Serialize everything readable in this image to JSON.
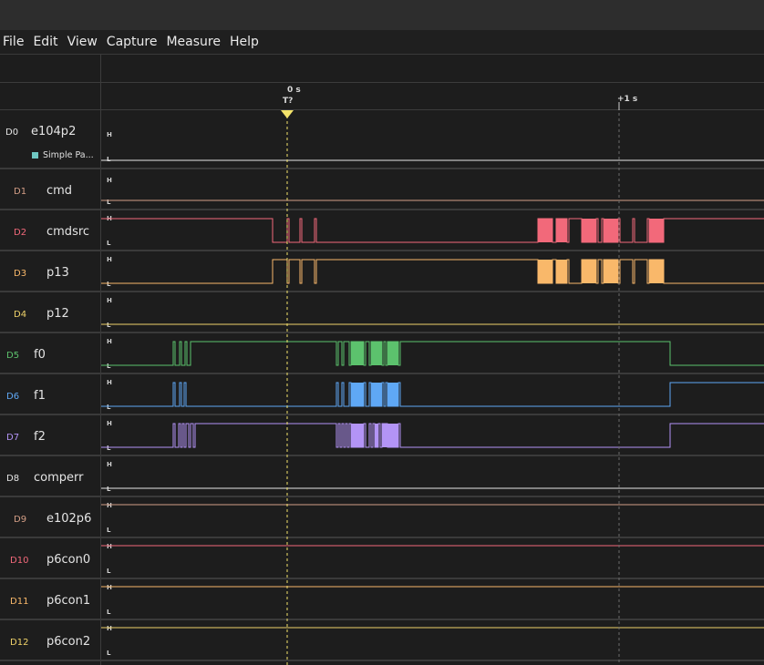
{
  "menu": [
    "File",
    "Edit",
    "View",
    "Capture",
    "Measure",
    "Help"
  ],
  "ruler": {
    "origin_label": "0 s",
    "trigger_label": "T?",
    "plus_one_label": "+1 s"
  },
  "decoder": {
    "label": "Simple Pa...",
    "color": "#6fc7c2"
  },
  "level_labels": {
    "high": "H",
    "low": "L"
  },
  "channels": [
    {
      "id": "D0",
      "name": "e104p2",
      "color": "#e6e6e6",
      "initial": "L"
    },
    {
      "id": "D1",
      "name": "cmd",
      "color": "#d49e86",
      "initial": "L"
    },
    {
      "id": "D2",
      "name": "cmdsrc",
      "color": "#f2697a",
      "initial": "H"
    },
    {
      "id": "D3",
      "name": "p13",
      "color": "#f9b86a",
      "initial": "L"
    },
    {
      "id": "D4",
      "name": "p12",
      "color": "#f0d36a",
      "initial": "L"
    },
    {
      "id": "D5",
      "name": "f0",
      "color": "#5cc26d",
      "initial": "L"
    },
    {
      "id": "D6",
      "name": "f1",
      "color": "#5fa8f5",
      "initial": "L"
    },
    {
      "id": "D7",
      "name": "f2",
      "color": "#b394f6",
      "initial": "L"
    },
    {
      "id": "D8",
      "name": "comperr",
      "color": "#e6e6e6",
      "initial": "L"
    },
    {
      "id": "D9",
      "name": "e102p6",
      "color": "#d49e86",
      "initial": "H"
    },
    {
      "id": "D10",
      "name": "p6con0",
      "color": "#f2697a",
      "initial": "H"
    },
    {
      "id": "D11",
      "name": "p6con1",
      "color": "#f9b86a",
      "initial": "H"
    },
    {
      "id": "D12",
      "name": "p6con2",
      "color": "#f0d36a",
      "initial": "H"
    }
  ]
}
